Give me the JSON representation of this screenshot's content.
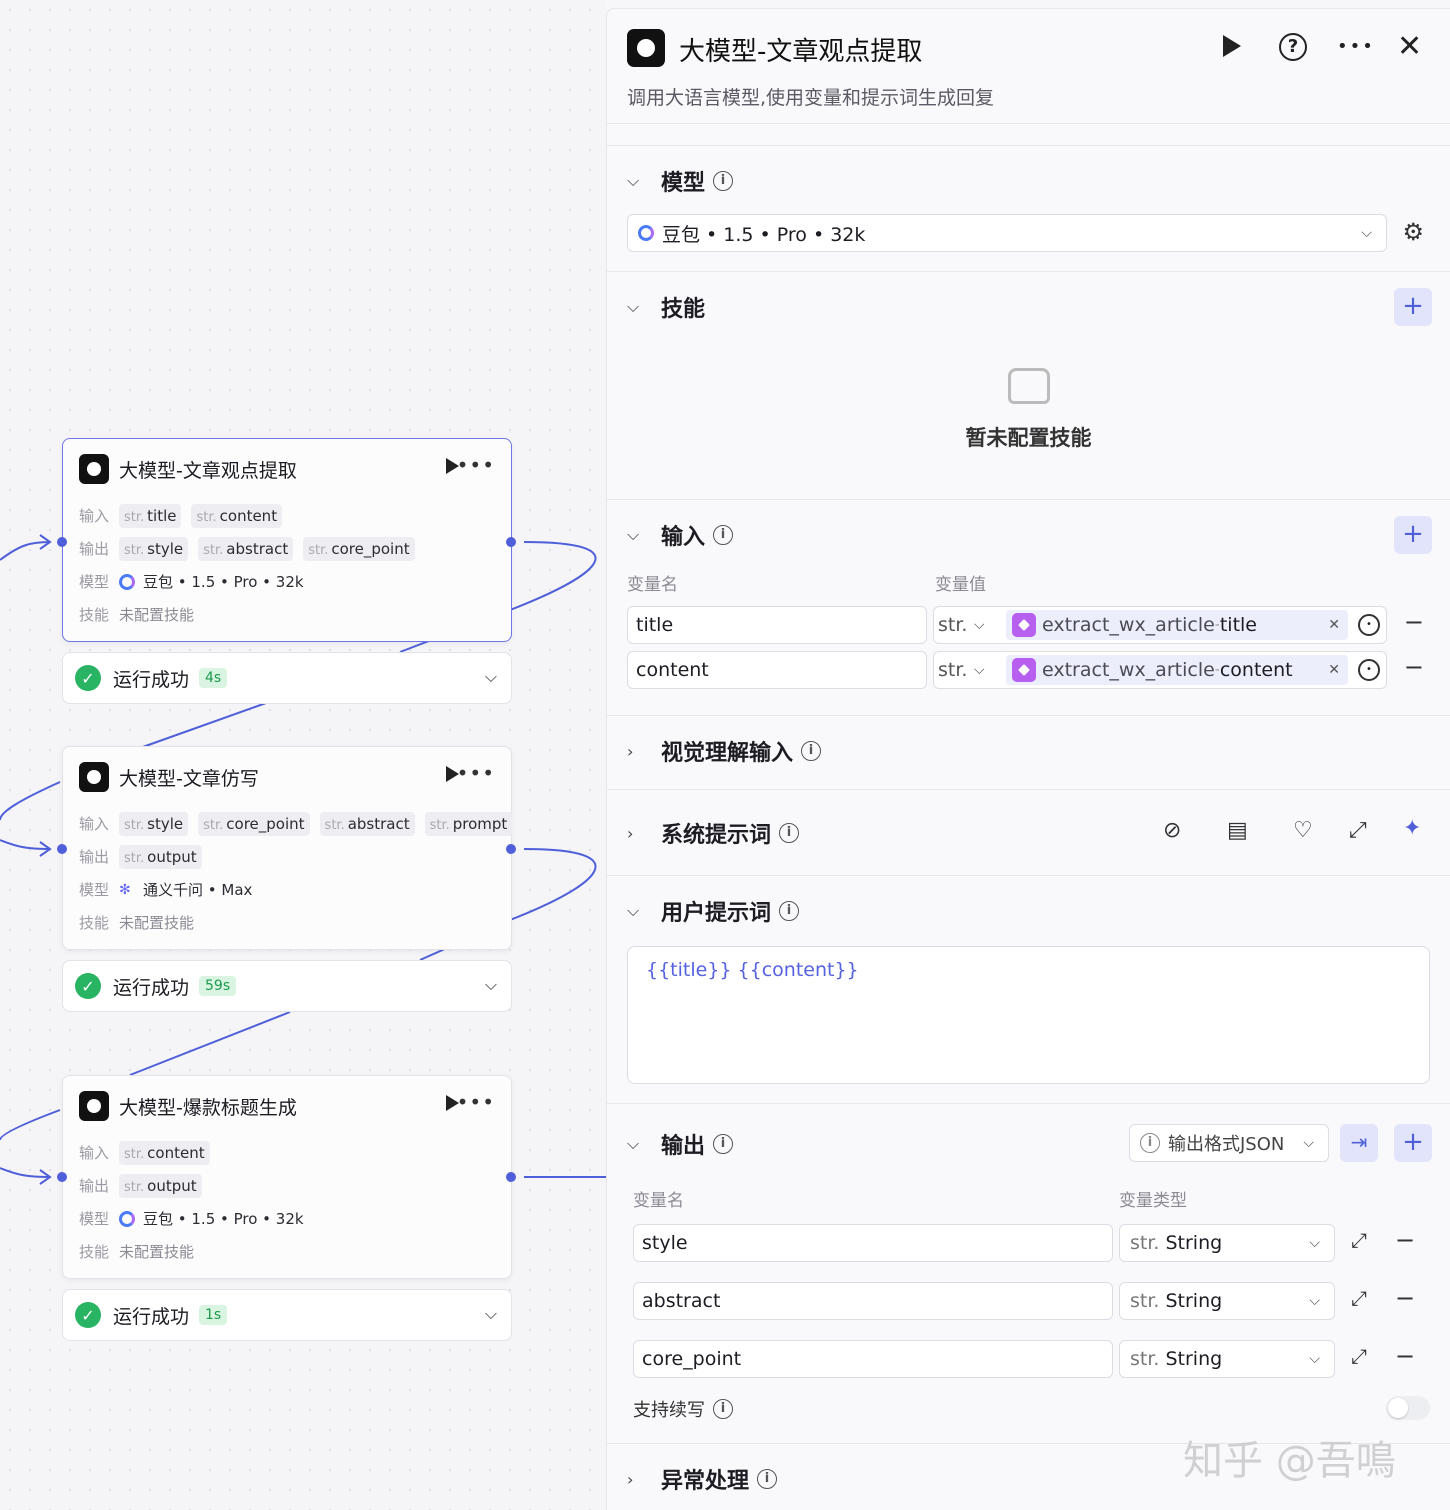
{
  "canvas": {
    "nodes": [
      {
        "title": "大模型-文章观点提取",
        "input_label": "输入",
        "inputs": [
          "title",
          "content"
        ],
        "output_label": "输出",
        "outputs": [
          "style",
          "abstract",
          "core_point"
        ],
        "model_label": "模型",
        "model": "豆包 • 1.5 • Pro • 32k",
        "skill_label": "技能",
        "skill": "未配置技能",
        "status": "运行成功",
        "time": "4s"
      },
      {
        "title": "大模型-文章仿写",
        "input_label": "输入",
        "inputs": [
          "style",
          "core_point",
          "abstract",
          "prompt"
        ],
        "output_label": "输出",
        "outputs": [
          "output"
        ],
        "model_label": "模型",
        "model": "通义千问 • Max",
        "skill_label": "技能",
        "skill": "未配置技能",
        "status": "运行成功",
        "time": "59s"
      },
      {
        "title": "大模型-爆款标题生成",
        "input_label": "输入",
        "inputs": [
          "content"
        ],
        "output_label": "输出",
        "outputs": [
          "output"
        ],
        "model_label": "模型",
        "model": "豆包 • 1.5 • Pro • 32k",
        "skill_label": "技能",
        "skill": "未配置技能",
        "status": "运行成功",
        "time": "1s"
      }
    ],
    "type_prefix": "str."
  },
  "panel": {
    "title": "大模型-文章观点提取",
    "description": "调用大语言模型,使用变量和提示词生成回复",
    "model_section": {
      "title": "模型",
      "selected": "豆包 • 1.5 • Pro • 32k"
    },
    "skills_section": {
      "title": "技能",
      "empty_text": "暂未配置技能"
    },
    "input_section": {
      "title": "输入",
      "col_name": "变量名",
      "col_value": "变量值",
      "rows": [
        {
          "name": "title",
          "type": "str.",
          "ref_source": "extract_wx_article",
          "ref_sep": " - ",
          "ref_field": "title"
        },
        {
          "name": "content",
          "type": "str.",
          "ref_source": "extract_wx_article",
          "ref_sep": " - ",
          "ref_field": "content"
        }
      ]
    },
    "vision_section": {
      "title": "视觉理解输入"
    },
    "system_prompt_section": {
      "title": "系统提示词"
    },
    "user_prompt_section": {
      "title": "用户提示词",
      "content": "{{title}} {{content}}"
    },
    "output_section": {
      "title": "输出",
      "format_label": "输出格式JSON",
      "col_name": "变量名",
      "col_type": "变量类型",
      "rows": [
        {
          "name": "style",
          "type_prefix": "str.",
          "type": "String"
        },
        {
          "name": "abstract",
          "type_prefix": "str.",
          "type": "String"
        },
        {
          "name": "core_point",
          "type_prefix": "str.",
          "type": "String"
        }
      ],
      "streaming_label": "支持续写",
      "streaming_enabled": false
    },
    "error_section": {
      "title": "异常处理"
    }
  },
  "watermark": "知乎 @吾鳴",
  "colors": {
    "accent": "#4e5fd9",
    "success": "#28b463",
    "var_ref": "#b760f0"
  }
}
